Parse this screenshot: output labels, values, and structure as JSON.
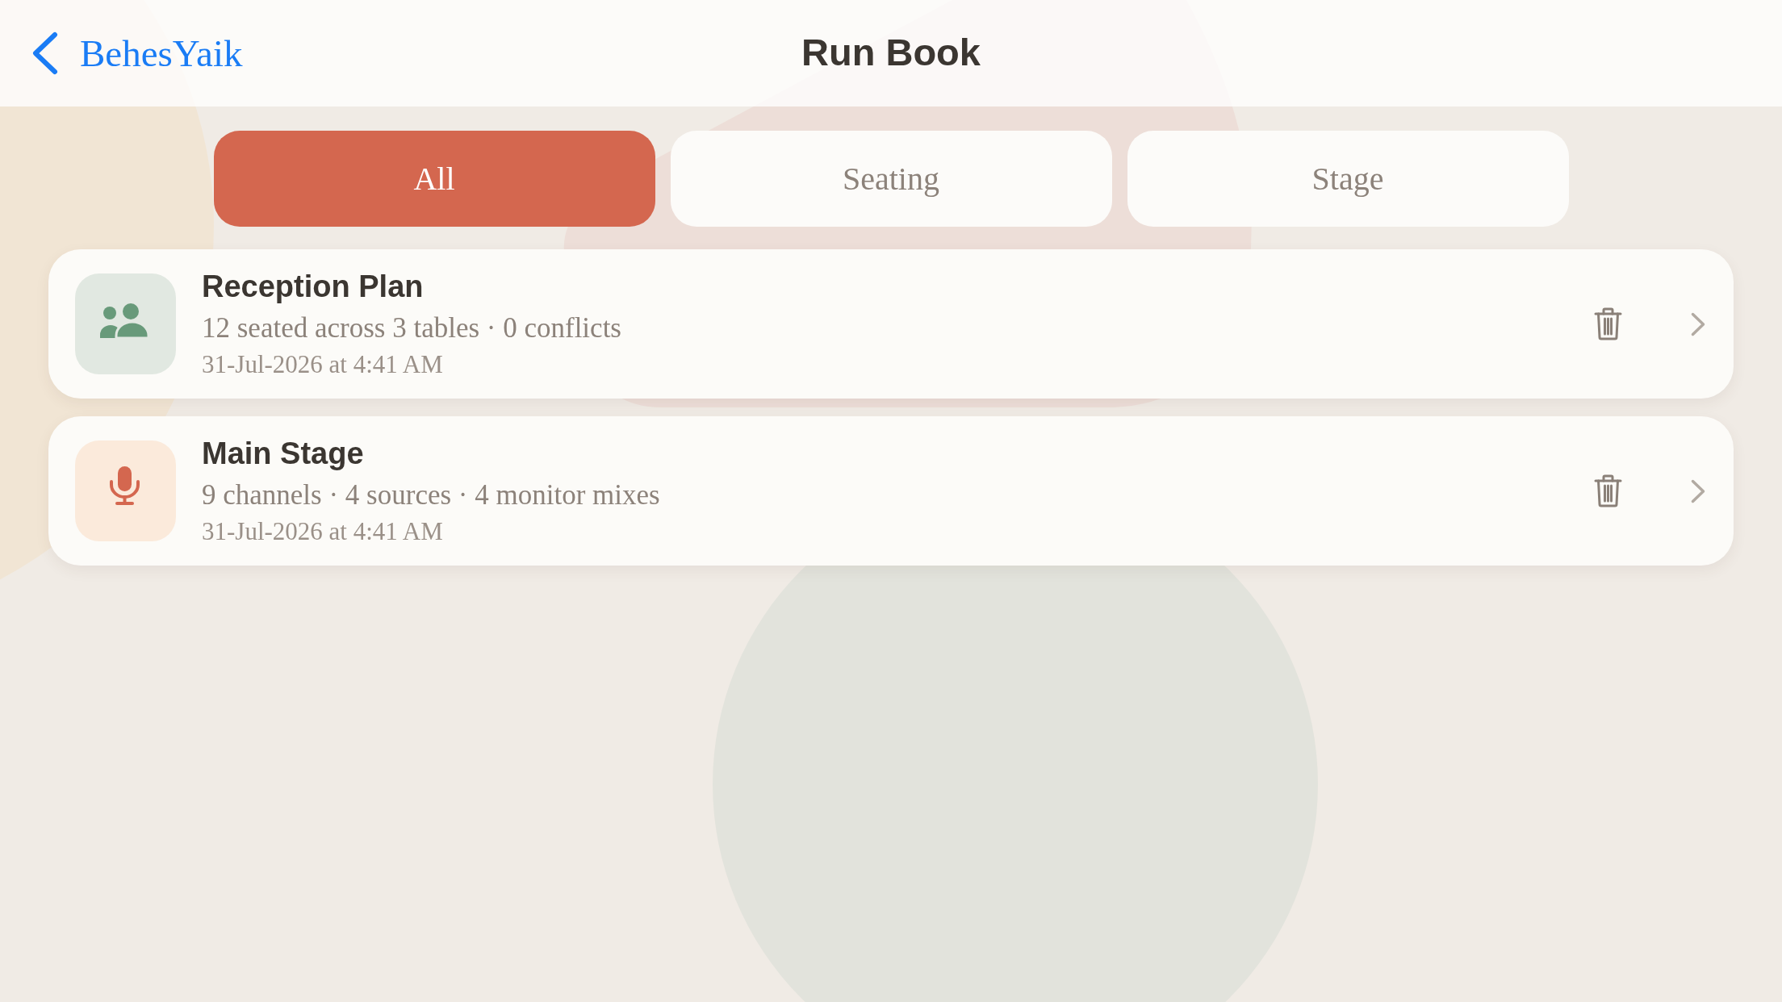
{
  "nav": {
    "back_label": "BehesYaik",
    "title": "Run Book"
  },
  "tabs": [
    {
      "label": "All",
      "selected": true
    },
    {
      "label": "Seating",
      "selected": false
    },
    {
      "label": "Stage",
      "selected": false
    }
  ],
  "items": [
    {
      "kind": "seating",
      "title": "Reception Plan",
      "summary": "12 seated across 3 tables · 0 conflicts",
      "date": "31-Jul-2026 at 4:41 AM"
    },
    {
      "kind": "stage",
      "title": "Main Stage",
      "summary": "9 channels · 4 sources · 4 monitor mixes",
      "date": "31-Jul-2026 at 4:41 AM"
    }
  ]
}
